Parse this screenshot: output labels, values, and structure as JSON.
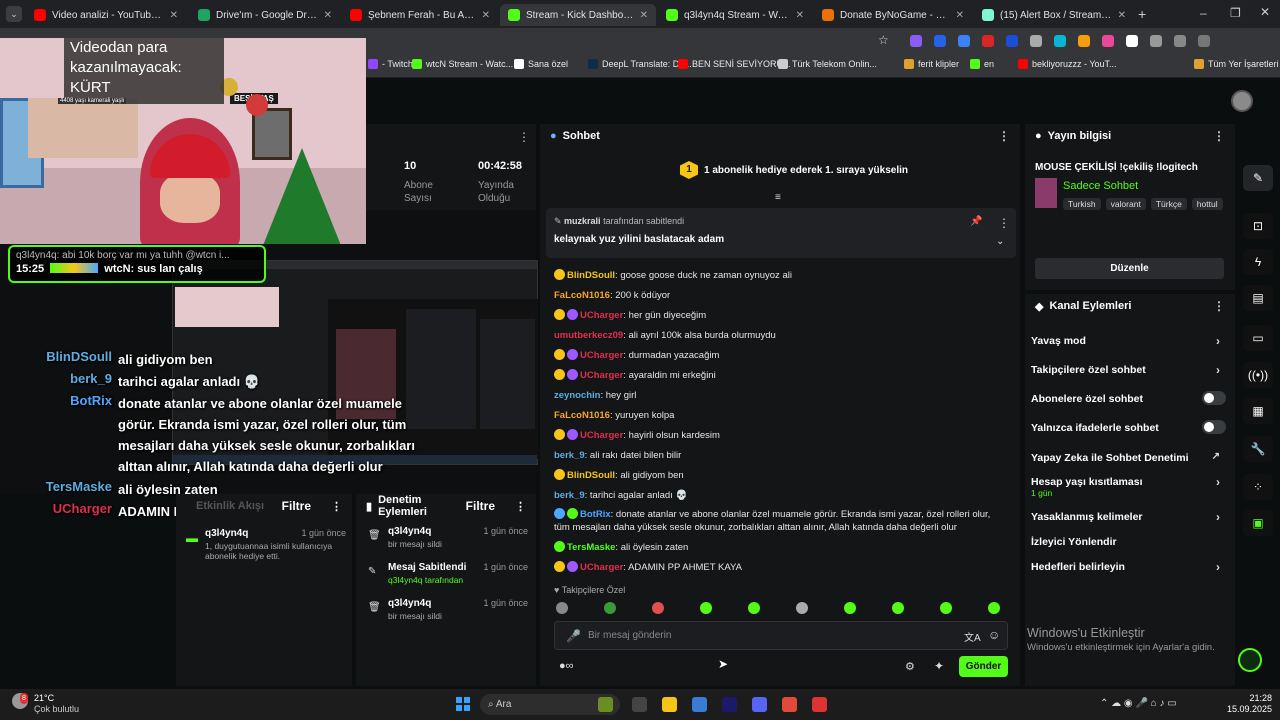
{
  "tabs": [
    {
      "label": "Video analizi - YouTube Studio",
      "color": "#ff0000"
    },
    {
      "label": "Drive'ım - Google Drive",
      "color": "#1fa463"
    },
    {
      "label": "Şebnem Ferah - Bu Aşk Fazla S...",
      "color": "#ff0000"
    },
    {
      "label": "Stream - Kick Dashboard",
      "color": "#53fc18"
    },
    {
      "label": "q3l4yn4q Stream - Watch Live o...",
      "color": "#53fc18"
    },
    {
      "label": "Donate ByNoGame - oyundiyo...",
      "color": "#e8710a"
    },
    {
      "label": "(15) Alert Box / Streamlabs",
      "color": "#80f5d2"
    }
  ],
  "bookmarks": [
    "- Twitch",
    "wtcN Stream - Watc...",
    "Sana özel",
    "DeepL Translate: Dü...",
    "BEN SENİ SEVİYORU...",
    "Türk Telekom Onlin...",
    "ferit klipler",
    "en",
    "bekliyoruzzz - YouT...",
    "Tüm Yer İşaretleri"
  ],
  "overlay": {
    "caption": "Videodan para kazanılmayacak: KÜRT",
    "sign": "BEŞİKTAŞ",
    "cam_text": "4408 yaşı kamerali yaşlı",
    "pinned_line": "q3l4yn4q: abi 10k borç var mı ya tuhh @wtcn i...",
    "pinned_time": "15:25",
    "pinned_user": "wtcN:",
    "pinned_msg": "sus lan çalış",
    "lines": [
      {
        "user": "BlinDSoull",
        "color": "#5dade2",
        "text": "ali gidiyom ben"
      },
      {
        "user": "berk_9",
        "color": "#5dade2",
        "text": "tarihci agalar anladı 💀"
      },
      {
        "user": "BotRix",
        "color": "#4ea6ff",
        "text": "donate atanlar ve abone olanlar özel muamele görür. Ekranda ismi yazar, özel rolleri olur, tüm mesajları daha yüksek sesle okunur, zorbalıkları alttan alınır, Allah katında daha değerli olur"
      },
      {
        "user": "TersMaske",
        "color": "#5dade2",
        "text": "ali öylesin zaten"
      },
      {
        "user": "UCharger",
        "color": "#e0304b",
        "text": "ADAMIN PP AHMET KAYA"
      }
    ]
  },
  "stats": [
    {
      "value": "10",
      "label": "Abone Sayısı"
    },
    {
      "value": "00:42:58",
      "label": "Yayında Olduğu"
    }
  ],
  "activity": {
    "title": "Etkinlik Akışı",
    "filter": "Filtre",
    "items": [
      {
        "user": "q3l4yn4q",
        "time": "1 gün önce",
        "text": "1, duygutuannaa isimli kullanıcıya abonelik hediye etti."
      }
    ]
  },
  "mod": {
    "title": "Denetim Eylemleri",
    "filter": "Filtre",
    "items": [
      {
        "user": "q3l4yn4q",
        "time": "1 gün önce",
        "text": "bir mesajı sildi"
      },
      {
        "user": "Mesaj Sabitlendi",
        "time": "1 gün önce",
        "text": "q3l4yn4q tarafından"
      },
      {
        "user": "q3l4yn4q",
        "time": "1 gün önce",
        "text": "bir mesajı sildi"
      }
    ]
  },
  "chat": {
    "title": "Sohbet",
    "goal": "1 abonelik hediye ederek 1. sıraya yükselin",
    "goal_num": "1",
    "pinned_by": "muzkrali",
    "pinned_by_suffix": "tarafından sabitlendi",
    "pinned_text": "kelaynak yuz yilini baslatacak adam",
    "messages": [
      {
        "user": "BlinDSoull",
        "color": "#f5c518",
        "text": "goose goose duck ne zaman oynuyoz ali"
      },
      {
        "user": "FaLcoN1016",
        "color": "#f5a623",
        "text": "200 k ödüyor"
      },
      {
        "user": "UCharger",
        "color": "#e0304b",
        "text": "her gün diyeceğim"
      },
      {
        "user": "umutberkecz09",
        "color": "#e0304b",
        "text": "ali ayrıl 100k alsa burda olurmuydu"
      },
      {
        "user": "UCharger",
        "color": "#e0304b",
        "text": "durmadan yazacağim"
      },
      {
        "user": "UCharger",
        "color": "#e0304b",
        "text": "ayaraldin mi erkeğini"
      },
      {
        "user": "zeynochin",
        "color": "#5dade2",
        "text": "hey girl"
      },
      {
        "user": "FaLcoN1016",
        "color": "#f5a623",
        "text": "yuruyen kolpa"
      },
      {
        "user": "UCharger",
        "color": "#e0304b",
        "text": "hayirli olsun kardesim"
      },
      {
        "user": "berk_9",
        "color": "#5dade2",
        "text": "ali rakı datei bilen bilir"
      },
      {
        "user": "BlinDSoull",
        "color": "#f5c518",
        "text": "ali gidiyom ben"
      },
      {
        "user": "berk_9",
        "color": "#5dade2",
        "text": "tarihci agalar anladı 💀"
      },
      {
        "user": "BotRix",
        "color": "#4ea6ff",
        "text": "donate atanlar ve abone olanlar özel muamele görür. Ekranda ismi yazar, özel rolleri olur, tüm mesajları daha yüksek sesle okunur, zorbalıkları alttan alınır, Allah katında daha değerli olur"
      },
      {
        "user": "TersMaske",
        "color": "#53fc18",
        "text": "ali öylesin zaten"
      },
      {
        "user": "UCharger",
        "color": "#e0304b",
        "text": "ADAMIN PP AHMET KAYA"
      }
    ],
    "followers_label": "Takipçilere Özel",
    "input_placeholder": "Bir mesaj gönderin",
    "send_label": "Gönder"
  },
  "streaminfo": {
    "title": "Yayın bilgisi",
    "stream_title": "MOUSE ÇEKİLİŞİ !çekiliş !logitech",
    "category": "Sadece Sohbet",
    "tags": [
      "Turkish",
      "valorant",
      "Türkçe",
      "hottul"
    ],
    "edit": "Düzenle"
  },
  "actions": {
    "title": "Kanal Eylemleri",
    "items": [
      {
        "label": "Yavaş mod",
        "type": "chev"
      },
      {
        "label": "Takipçilere özel sohbet",
        "type": "chev"
      },
      {
        "label": "Abonelere özel sohbet",
        "type": "toggle"
      },
      {
        "label": "Yalnızca ifadelerle sohbet",
        "type": "toggle"
      },
      {
        "label": "Yapay Zeka ile Sohbet Denetimi",
        "type": "ext"
      },
      {
        "label": "Hesap yaşı kısıtlaması",
        "sub": "1 gün",
        "type": "chev"
      },
      {
        "label": "Yasaklanmış kelimeler",
        "type": "chev"
      },
      {
        "label": "İzleyici Yönlendir",
        "type": "none"
      },
      {
        "label": "Hedefleri belirleyin",
        "type": "chev"
      }
    ]
  },
  "watermark": {
    "title": "Windows'u Etkinleştir",
    "sub": "Windows'u etkinleştirmek için Ayarlar'a gidin."
  },
  "taskbar": {
    "weather_temp": "21°C",
    "weather_text": "Çok bulutlu",
    "weather_badge": "8",
    "search": "Ara",
    "time": "21:28",
    "date": "15.09.2025"
  }
}
